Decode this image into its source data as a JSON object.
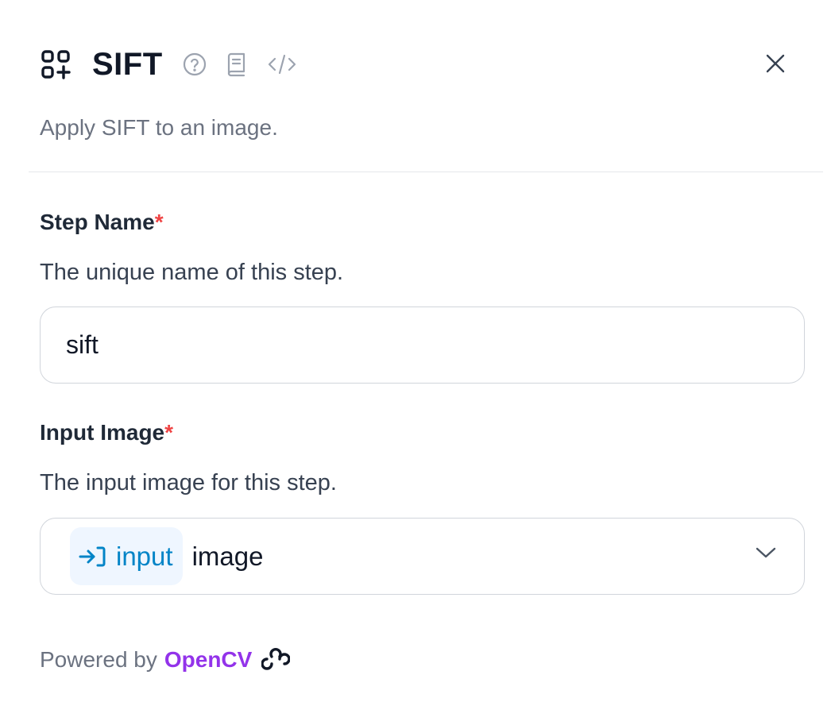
{
  "panel": {
    "title": "SIFT",
    "description": "Apply SIFT to an image."
  },
  "icons": {
    "block": "block-grid-plus-icon",
    "help": "help-circle-icon",
    "docs": "book-icon",
    "code": "code-icon",
    "close": "close-icon",
    "chip": "arrow-into-icon",
    "dropdown": "chevron-down-icon",
    "brand": "opencv-logo-icon"
  },
  "fields": {
    "step_name": {
      "label": "Step Name",
      "required_mark": "*",
      "help": "The unique name of this step.",
      "value": "sift"
    },
    "input_image": {
      "label": "Input Image",
      "required_mark": "*",
      "help": "The input image for this step.",
      "chip": "input",
      "value": "image"
    }
  },
  "footer": {
    "prefix": "Powered by",
    "brand": "OpenCV"
  },
  "colors": {
    "required": "#ef4444",
    "chip_text": "#0284c7",
    "chip_bg": "#eff6ff",
    "brand": "#9333ea"
  }
}
